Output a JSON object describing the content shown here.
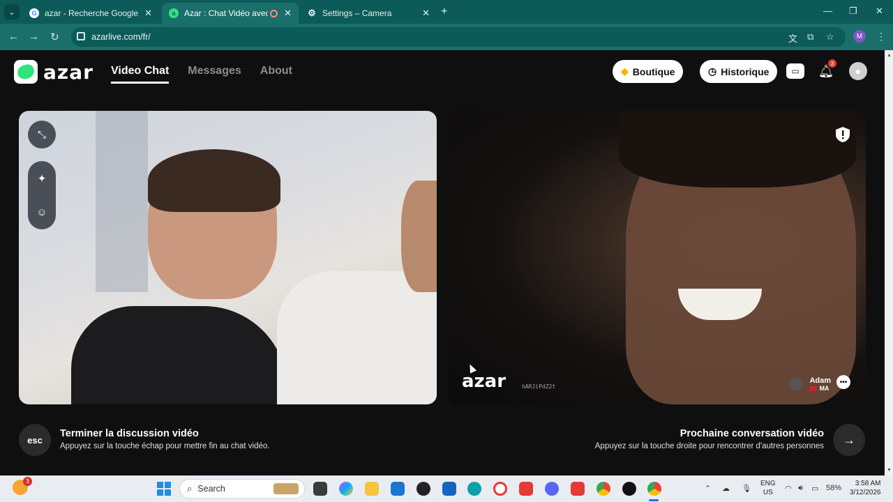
{
  "browser": {
    "tabs": [
      {
        "title": "azar - Recherche Google",
        "favicon": "google-icon"
      },
      {
        "title": "Azar : Chat Vidéo avec de r",
        "favicon": "azar-icon"
      },
      {
        "title": "Settings – Camera",
        "favicon": "gear-icon"
      }
    ],
    "url": "azarlive.com/fr/",
    "profile_initial": "M"
  },
  "header": {
    "logo_text": "azar",
    "nav": [
      "Video Chat",
      "Messages",
      "About"
    ],
    "shop_label": "Boutique",
    "history_label": "Historique",
    "notification_count": "3"
  },
  "video": {
    "watermark": "azar",
    "session_id": "hARJiPdZ2t",
    "peer_name": "Adam",
    "peer_country": "MA"
  },
  "footer": {
    "esc_key": "esc",
    "end_title": "Terminer la discussion vidéo",
    "end_desc": "Appuyez sur la touche échap pour mettre fin au chat vidéo.",
    "next_title": "Prochaine conversation vidéo",
    "next_desc": "Appuyez sur la touche droite pour rencontrer d'autres personnes",
    "next_key": "→"
  },
  "taskbar": {
    "weather_badge": "3",
    "search_placeholder": "Search",
    "lang_line1": "ENG",
    "lang_line2": "US",
    "battery": "58%",
    "time": "3:58 AM",
    "date": "3/12/2026"
  },
  "colors": {
    "chrome_tabstrip": "#0c5b58",
    "chrome_toolbar": "#1a6f6b",
    "page_bg": "#0f0f0f",
    "azar_green": "#2ee57a",
    "notification_red": "#e53935"
  }
}
